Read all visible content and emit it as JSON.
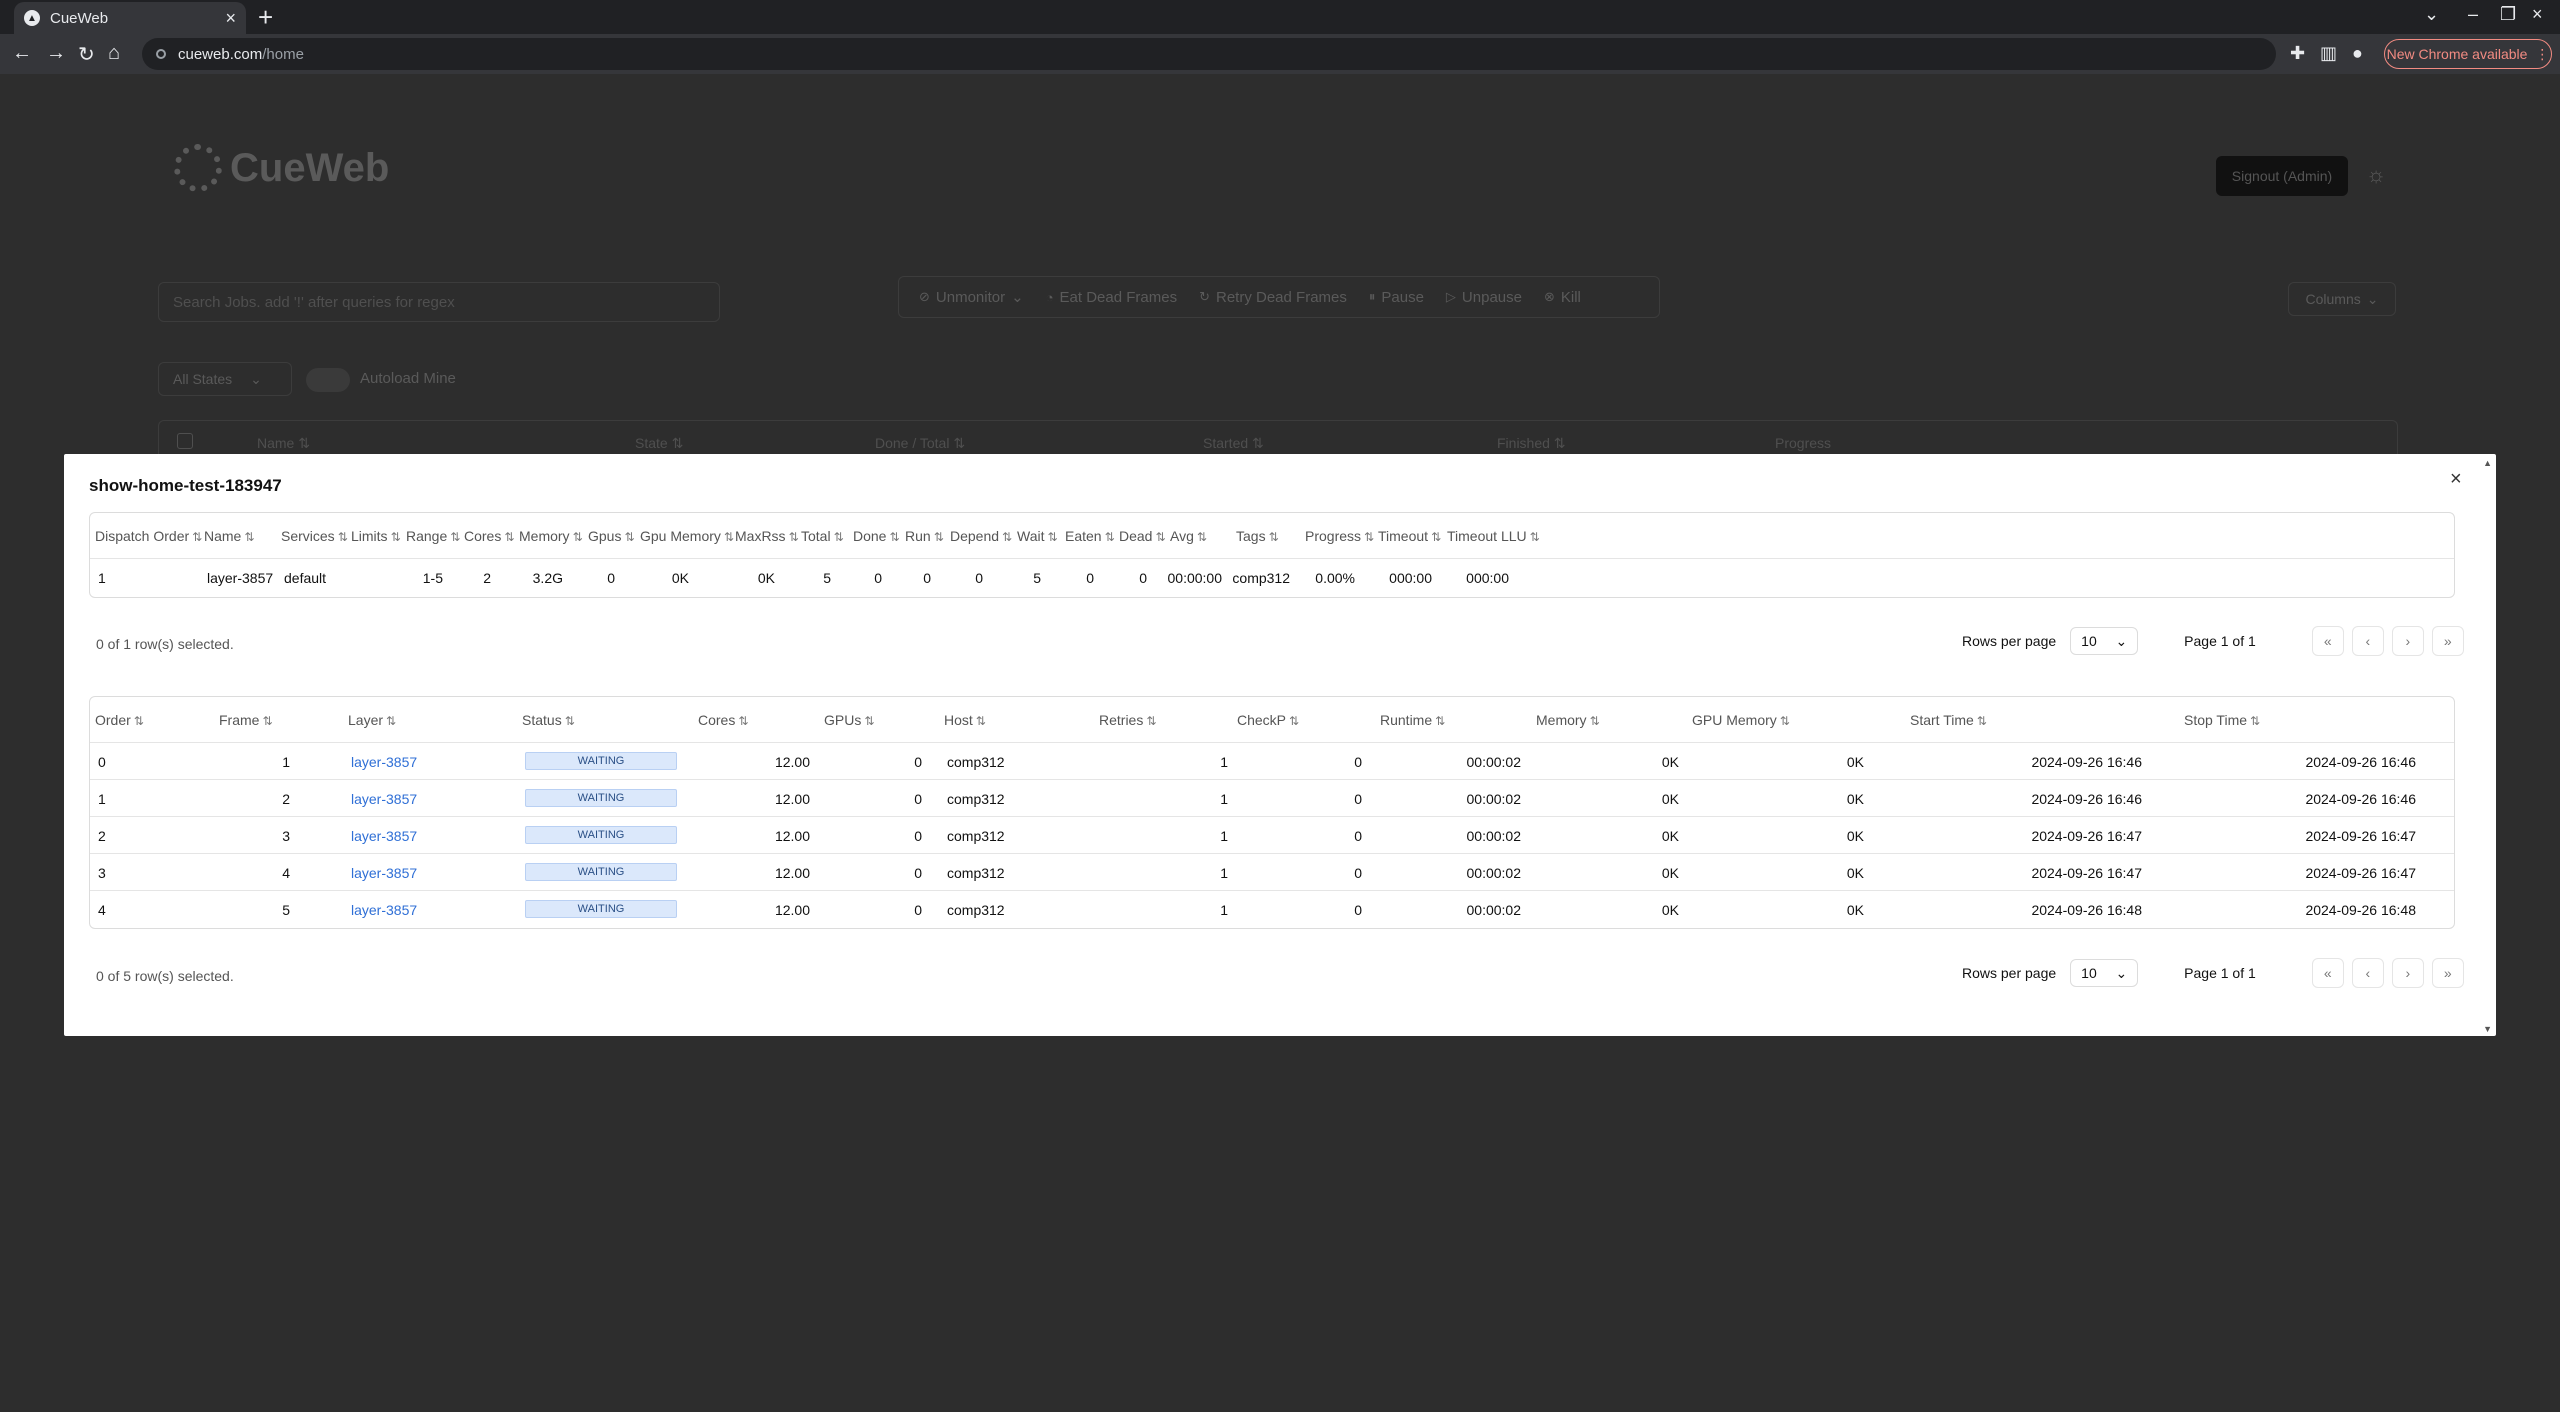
{
  "browser": {
    "tab_title": "CueWeb",
    "url_host": "cueweb.com",
    "url_path": "/home",
    "update_label": "New Chrome available"
  },
  "page": {
    "logo_text": "CueWeb",
    "signout_label": "Signout (Admin)",
    "search_placeholder": "Search Jobs. add '!' after queries for regex",
    "actions": [
      {
        "icon": "eye-off-icon",
        "label": "Unmonitor"
      },
      {
        "icon": "eat-icon",
        "label": "Eat Dead Frames"
      },
      {
        "icon": "retry-icon",
        "label": "Retry Dead Frames"
      },
      {
        "icon": "pause-icon",
        "label": "Pause"
      },
      {
        "icon": "play-icon",
        "label": "Unpause"
      },
      {
        "icon": "kill-icon",
        "label": "Kill"
      }
    ],
    "columns_label": "Columns",
    "state_filter": "All States",
    "autoload_label": "Autoload Mine",
    "jobs_headers": [
      "Name",
      "State",
      "Done / Total",
      "Started",
      "Finished",
      "Progress"
    ]
  },
  "modal": {
    "title": "show-home-test-183947",
    "layers": {
      "headers": [
        "Dispatch Order",
        "Name",
        "Services",
        "Limits",
        "Range",
        "Cores",
        "Memory",
        "Gpus",
        "Gpu Memory",
        "MaxRss",
        "Total",
        "Done",
        "Run",
        "Depend",
        "Wait",
        "Eaten",
        "Dead",
        "Avg",
        "Tags",
        "Progress",
        "Timeout",
        "Timeout LLU"
      ],
      "rows": [
        [
          "1",
          "layer-3857",
          "default",
          "",
          "1-5",
          "2",
          "3.2G",
          "0",
          "0K",
          "0K",
          "5",
          "0",
          "0",
          "0",
          "5",
          "0",
          "0",
          "00:00:00",
          "comp312",
          "0.00%",
          "000:00",
          "000:00"
        ]
      ],
      "selection": "0 of 1 row(s) selected.",
      "rows_per_page_label": "Rows per page",
      "rows_per_page": "10",
      "page_label": "Page 1 of 1"
    },
    "frames": {
      "headers": [
        "Order",
        "Frame",
        "Layer",
        "Status",
        "Cores",
        "GPUs",
        "Host",
        "Retries",
        "CheckP",
        "Runtime",
        "Memory",
        "GPU Memory",
        "Start Time",
        "Stop Time"
      ],
      "rows": [
        [
          "0",
          "1",
          "layer-3857",
          "WAITING",
          "12.00",
          "0",
          "comp312",
          "1",
          "0",
          "00:00:02",
          "0K",
          "0K",
          "2024-09-26 16:46",
          "2024-09-26 16:46"
        ],
        [
          "1",
          "2",
          "layer-3857",
          "WAITING",
          "12.00",
          "0",
          "comp312",
          "1",
          "0",
          "00:00:02",
          "0K",
          "0K",
          "2024-09-26 16:46",
          "2024-09-26 16:46"
        ],
        [
          "2",
          "3",
          "layer-3857",
          "WAITING",
          "12.00",
          "0",
          "comp312",
          "1",
          "0",
          "00:00:02",
          "0K",
          "0K",
          "2024-09-26 16:47",
          "2024-09-26 16:47"
        ],
        [
          "3",
          "4",
          "layer-3857",
          "WAITING",
          "12.00",
          "0",
          "comp312",
          "1",
          "0",
          "00:00:02",
          "0K",
          "0K",
          "2024-09-26 16:47",
          "2024-09-26 16:47"
        ],
        [
          "4",
          "5",
          "layer-3857",
          "WAITING",
          "12.00",
          "0",
          "comp312",
          "1",
          "0",
          "00:00:02",
          "0K",
          "0K",
          "2024-09-26 16:48",
          "2024-09-26 16:48"
        ]
      ],
      "selection": "0 of 5 row(s) selected.",
      "rows_per_page_label": "Rows per page",
      "rows_per_page": "10",
      "page_label": "Page 1 of 1"
    }
  }
}
